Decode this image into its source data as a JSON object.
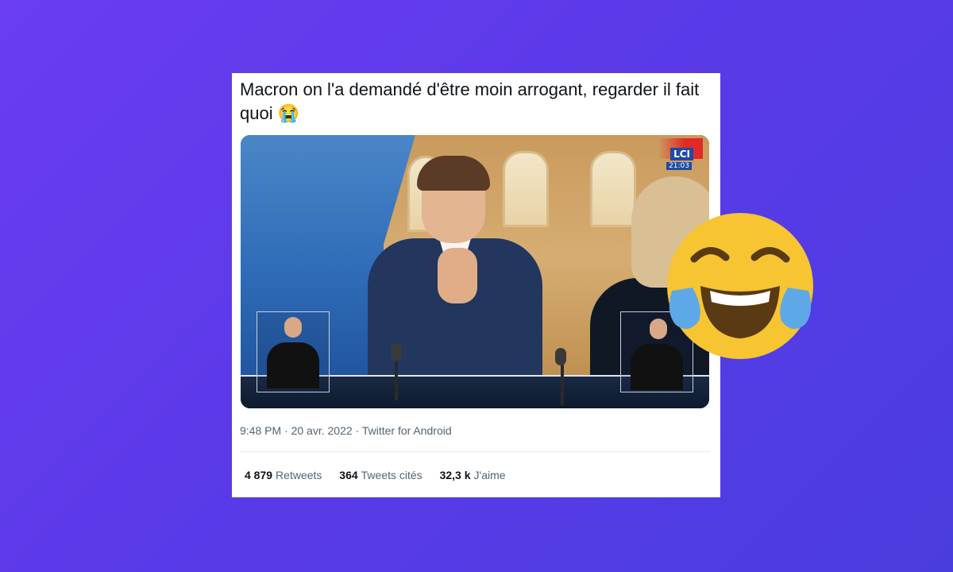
{
  "tweet": {
    "text": "Macron on l'a demandé d'être moin arrogant, regarder il fait quoi",
    "inline_emoji": "😭",
    "meta": "9:48 PM · 20 avr. 2022 · Twitter for Android",
    "stats": [
      {
        "value": "4 879",
        "label": "Retweets"
      },
      {
        "value": "364",
        "label": "Tweets cités"
      },
      {
        "value": "32,3 k",
        "label": "J'aime"
      }
    ]
  },
  "media": {
    "channel_logo": "LCI",
    "channel_time": "21:03"
  },
  "decor": {
    "big_emoji": "face-with-tears-of-joy",
    "background_color": "#5b3ae8",
    "emoji_color": "#f6c531",
    "tear_color": "#5fa8e8"
  }
}
